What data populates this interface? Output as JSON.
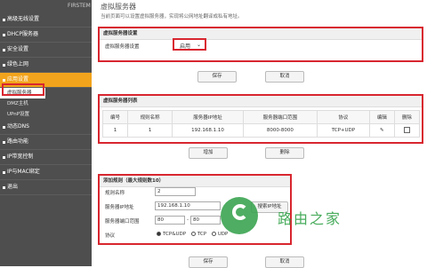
{
  "sidebar": {
    "brand": "FIRSTEM",
    "items": [
      {
        "label": "高级无线设置"
      },
      {
        "label": "DHCP服务器"
      },
      {
        "label": "安全设置"
      },
      {
        "label": "绿色上网"
      },
      {
        "label": "应用设置"
      }
    ],
    "sub_items": [
      {
        "label": "虚拟服务器"
      },
      {
        "label": "DMZ主机"
      },
      {
        "label": "UPnP设置"
      }
    ],
    "items_after": [
      {
        "label": "动态DNS"
      },
      {
        "label": "路由功能"
      },
      {
        "label": "IP带宽控制"
      },
      {
        "label": "IP与MAC绑定"
      },
      {
        "label": "退出"
      }
    ]
  },
  "main": {
    "title": "虚拟服务器",
    "description": "当前页面可以设置虚拟服务器，实现将公网地址翻译成私有地址。",
    "settings": {
      "header": "虚拟服务器设置",
      "label": "虚拟服务器设置",
      "value": "启用",
      "save": "保存",
      "cancel": "取消"
    },
    "list": {
      "header": "虚拟服务器列表",
      "columns": [
        "编号",
        "规则名称",
        "服务器IP地址",
        "服务器端口范围",
        "协议",
        "编辑",
        "删除"
      ],
      "rows": [
        {
          "no": "1",
          "name": "1",
          "ip": "192.168.1.10",
          "ports": "8000-8000",
          "protocol": "TCP+UDP"
        }
      ],
      "add": "增加",
      "delete": "删除"
    },
    "add_rule": {
      "header": "添加规则（最大规则数10）",
      "name_label": "规则名称",
      "name_value": "2",
      "ip_label": "服务器IP地址",
      "ip_value": "192.168.1.10",
      "lookup_button": "搜索IP地址",
      "port_label": "服务器端口范围",
      "port_from": "80",
      "port_to": "80",
      "protocol_label": "协议",
      "protocol_options": [
        "TCP&UDP",
        "TCP",
        "UDP"
      ],
      "protocol_selected": "TCP&UDP",
      "save": "保存",
      "cancel": "取消"
    }
  },
  "watermark": {
    "text": "路由之家"
  },
  "colors": {
    "sidebar": "#4e4e4e",
    "active": "#f2a41c",
    "highlight": "#d8262f",
    "watermark": "#34a24a"
  }
}
